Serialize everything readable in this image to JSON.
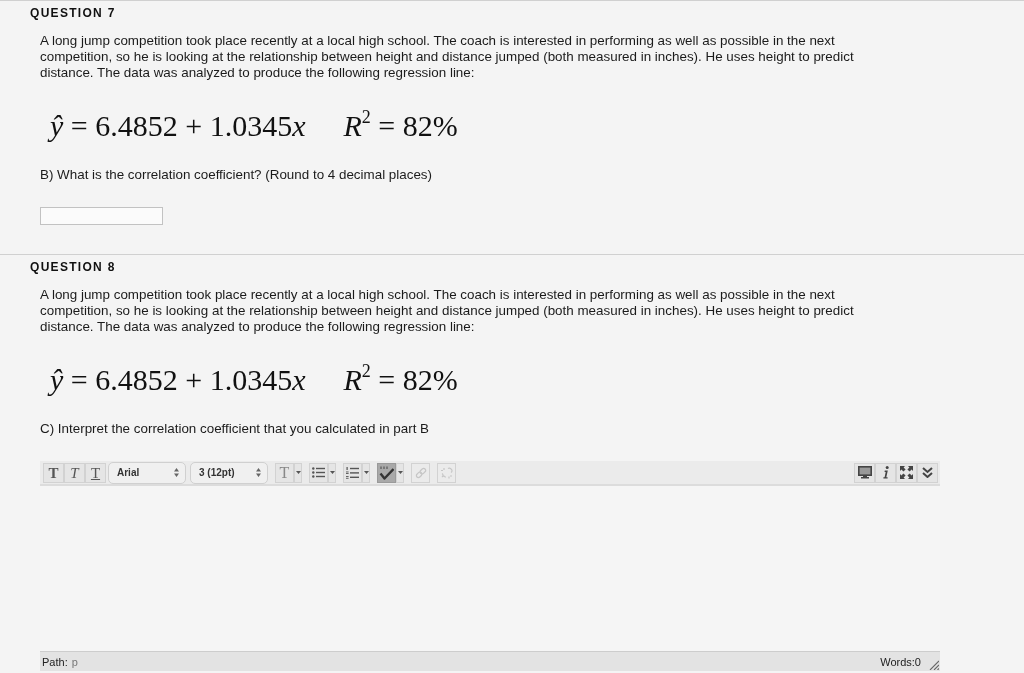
{
  "questions": [
    {
      "title": "QUESTION 7",
      "text": "A long jump competition took place recently at a local high school. The coach is interested in performing as well as possible in the next competition, so he is looking at the relationship between height and distance jumped (both measured in inches). He uses height to predict distance. The data was analyzed to produce the following regression line:",
      "equation": [
        {
          "text": "ŷ",
          "italic": true
        },
        {
          "text": " = 6.4852 + 1.0345",
          "italic": false
        },
        {
          "text": "x",
          "italic": true
        }
      ],
      "r_squared": "*R*$^{2}$ = 82%",
      "prompt": "B) What is the correlation coefficient? (Round to 4 decimal places)",
      "answer": {
        "kind": "input"
      }
    },
    {
      "title": "QUESTION 8",
      "text": "A long jump competition took place recently at a local high school. The coach is interested in performing as well as possible in the next competition, so he is looking at the relationship between height and distance jumped (both measured in inches). He uses height to predict distance. The data was analyzed to produce the following regression line:",
      "equation": [
        {
          "text": "ŷ",
          "italic": true
        },
        {
          "text": " = 6.4852 + 1.0345",
          "italic": false
        },
        {
          "text": "x",
          "italic": true
        }
      ],
      "r_squared": "*R*$^{2}$ = 82%",
      "prompt": "C) Interpret the correlation coefficient that you calculated in part B",
      "answer": {
        "kind": "editor",
        "toolbar": {
          "format_buttons": [
            {
              "kind": "bold",
              "label": "T"
            },
            {
              "kind": "italic",
              "label": "T"
            },
            {
              "kind": "underline",
              "label": "T"
            }
          ],
          "font_select": {
            "value": "Arial"
          },
          "size_select": {
            "value": "3 (12pt)"
          },
          "tools": [
            {
              "kind": "text-color",
              "label": "T",
              "menu": true,
              "on": false,
              "disabled": false
            },
            {
              "kind": "bullet-list",
              "menu": true,
              "on": false,
              "disabled": false
            },
            {
              "kind": "numbered-list",
              "menu": true,
              "on": false,
              "disabled": false
            },
            {
              "kind": "spellcheck",
              "menu": true,
              "on": true,
              "disabled": false
            },
            {
              "kind": "link",
              "menu": false,
              "on": false,
              "disabled": true
            },
            {
              "kind": "unlink",
              "menu": false,
              "on": false,
              "disabled": true
            }
          ],
          "right_tools": [
            {
              "kind": "preview"
            },
            {
              "kind": "info"
            },
            {
              "kind": "fullscreen"
            },
            {
              "kind": "expand"
            }
          ]
        },
        "status_bar": {
          "path_label": "Path:",
          "path_value": "p",
          "word_count": "Words:0"
        }
      }
    }
  ]
}
